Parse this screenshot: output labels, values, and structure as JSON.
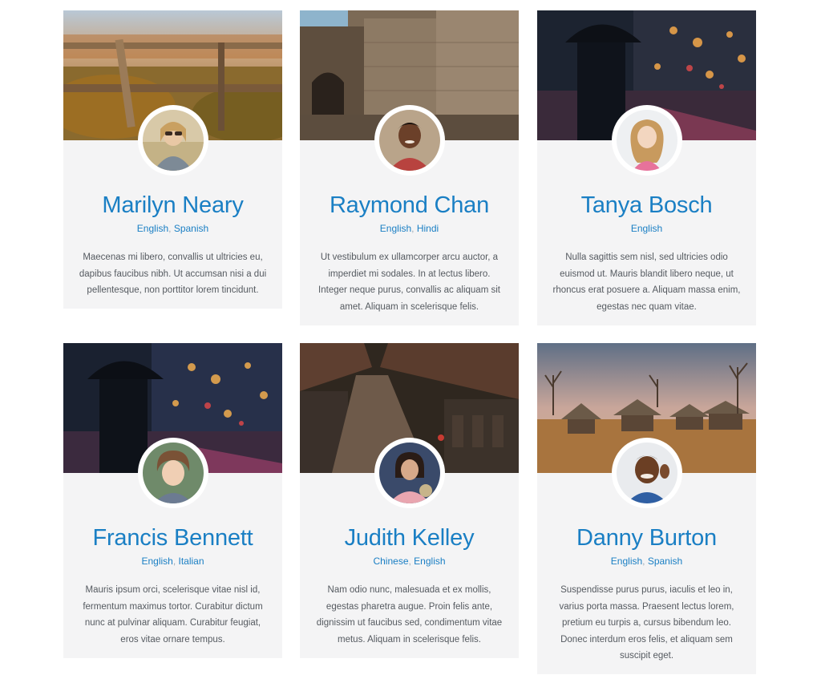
{
  "cards": [
    {
      "name": "Marilyn Neary",
      "languages": [
        "English",
        "Spanish"
      ],
      "bio": "Maecenas mi libero, convallis ut ultricies eu, dapibus faucibus nibh. Ut accumsan nisi a dui pellentesque, non porttitor lorem tincidunt."
    },
    {
      "name": "Raymond Chan",
      "languages": [
        "English",
        "Hindi"
      ],
      "bio": "Ut vestibulum ex ullamcorper arcu auctor, a imperdiet mi sodales. In at lectus libero. Integer neque purus, convallis ac aliquam sit amet. Aliquam in scelerisque felis."
    },
    {
      "name": "Tanya Bosch",
      "languages": [
        "English"
      ],
      "bio": "Nulla sagittis sem nisl, sed ultricies odio euismod ut. Mauris blandit libero neque, ut rhoncus erat posuere a. Aliquam massa enim, egestas nec quam vitae."
    },
    {
      "name": "Francis Bennett",
      "languages": [
        "English",
        "Italian"
      ],
      "bio": "Mauris ipsum orci, scelerisque vitae nisl id, fermentum maximus tortor. Curabitur dictum nunc at pulvinar aliquam. Curabitur feugiat, eros vitae ornare tempus."
    },
    {
      "name": "Judith Kelley",
      "languages": [
        "Chinese",
        "English"
      ],
      "bio": "Nam odio nunc, malesuada et ex mollis, egestas pharetra augue. Proin felis ante, dignissim ut faucibus sed, condimentum vitae metus. Aliquam in scelerisque felis."
    },
    {
      "name": "Danny Burton",
      "languages": [
        "English",
        "Spanish"
      ],
      "bio": "Suspendisse purus purus, iaculis et leo in, varius porta massa. Praesent lectus lorem, pretium eu turpis a, cursus bibendum leo. Donec interdum eros felis, et aliquam sem suscipit eget."
    }
  ],
  "colors": {
    "name": "#1a7fc4",
    "card_background": "#f4f4f5",
    "bio_text": "#555a60"
  }
}
